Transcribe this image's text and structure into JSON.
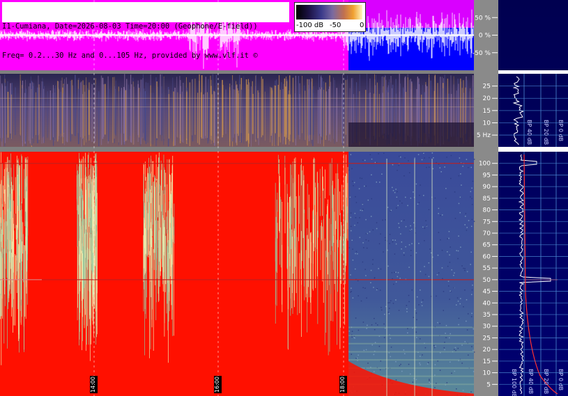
{
  "header": {
    "line1": "I1-Cumiana, Date=2026-08-03 Time=20:00 (Geophone/E-field))",
    "line2": "Freq= 0.2...30 Hz and 0...105 Hz, provided by www.vlf.it ©"
  },
  "colorbar": {
    "labels": [
      "-100 dB",
      "-50",
      "0"
    ]
  },
  "chart_data": [
    {
      "type": "line",
      "panel": "waveform",
      "y_ticks": [
        "50 %",
        "0 %",
        "-50 %"
      ],
      "y_values": [
        50,
        0,
        -50
      ],
      "ylim": [
        -100,
        100
      ],
      "background_colors": {
        "left": "#ff00ff",
        "right": "#0000ff"
      },
      "color_change_time": "17:00"
    },
    {
      "type": "heatmap",
      "panel": "spectrogram-low",
      "y_ticks": [
        "25",
        "20",
        "15",
        "10",
        "5 Hz"
      ],
      "y_values": [
        25,
        20,
        15,
        10,
        5
      ],
      "ylim": [
        0.2,
        30
      ],
      "colormap": [
        "#1a1040",
        "#3a3a8a",
        "#7a6aa0",
        "#c07050",
        "#f0a030",
        "#fff6c0"
      ]
    },
    {
      "type": "heatmap",
      "panel": "spectrogram-high",
      "y_ticks": [
        "100",
        "95",
        "90",
        "85",
        "80",
        "75",
        "70",
        "65",
        "60",
        "55",
        "50",
        "45",
        "40",
        "35",
        "30",
        "25",
        "20",
        "15",
        "10",
        "5"
      ],
      "y_values": [
        100,
        95,
        90,
        85,
        80,
        75,
        70,
        65,
        60,
        55,
        50,
        45,
        40,
        35,
        30,
        25,
        20,
        15,
        10,
        5
      ],
      "ylim": [
        0,
        105
      ],
      "x_ticks": [
        "14:00",
        "16:00",
        "18:00"
      ],
      "saturated_color": "#ff1000",
      "quiet_color": "#3a4a9a"
    },
    {
      "type": "line",
      "panel": "spectrum-side",
      "bp_labels": [
        "100 dB",
        "40 dB",
        "20 dB",
        "0 dB"
      ],
      "bp_labels_low": [
        "40 dB",
        "20 dB",
        "0 dB"
      ]
    }
  ]
}
